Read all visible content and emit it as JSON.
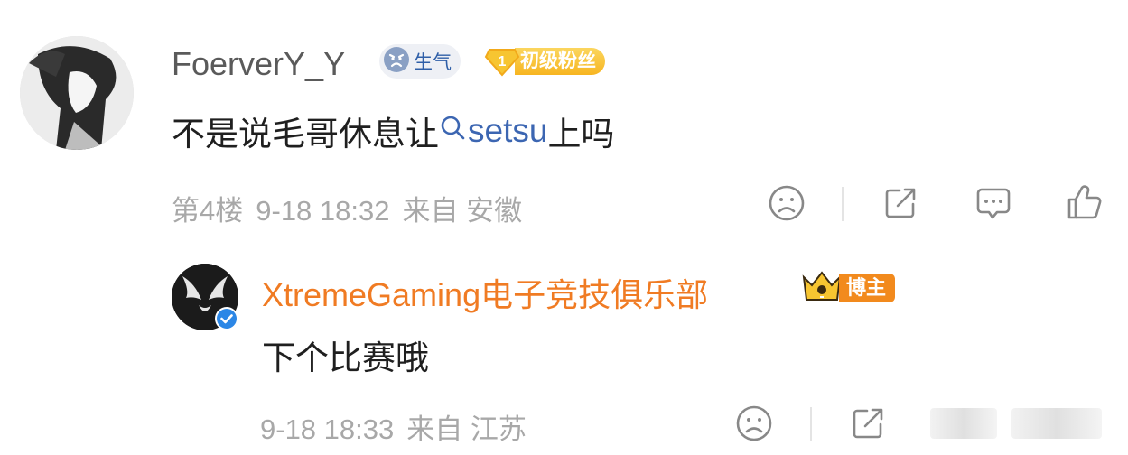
{
  "comment": {
    "username": "FoerverY_Y",
    "mood_badge": {
      "icon": "angry-face-icon",
      "label": "生气"
    },
    "fan_badge": {
      "level": "1",
      "label": "初级粉丝",
      "color": "#f7b521"
    },
    "text_before": "不是说毛哥休息让",
    "mention": "setsu",
    "text_after": "上吗",
    "floor": "第4楼",
    "datetime": "9-18 18:32",
    "location": "来自 安徽",
    "actions": [
      "sad-face-icon",
      "share-icon",
      "comment-icon",
      "like-icon"
    ]
  },
  "reply": {
    "username": "XtremeGaming电子竞技俱乐部",
    "blogger_badge": {
      "label": "博主",
      "color": "#f28a1d"
    },
    "text": "下个比赛哦",
    "datetime": "9-18 18:33",
    "location": "来自 江苏",
    "actions": [
      "sad-face-icon",
      "share-icon",
      "comment-icon",
      "like-icon"
    ]
  },
  "colors": {
    "username_gray": "#5a5a5a",
    "reply_name_orange": "#f07b23",
    "link_blue": "#3c66b2",
    "meta_gray": "#a8a8a8"
  }
}
